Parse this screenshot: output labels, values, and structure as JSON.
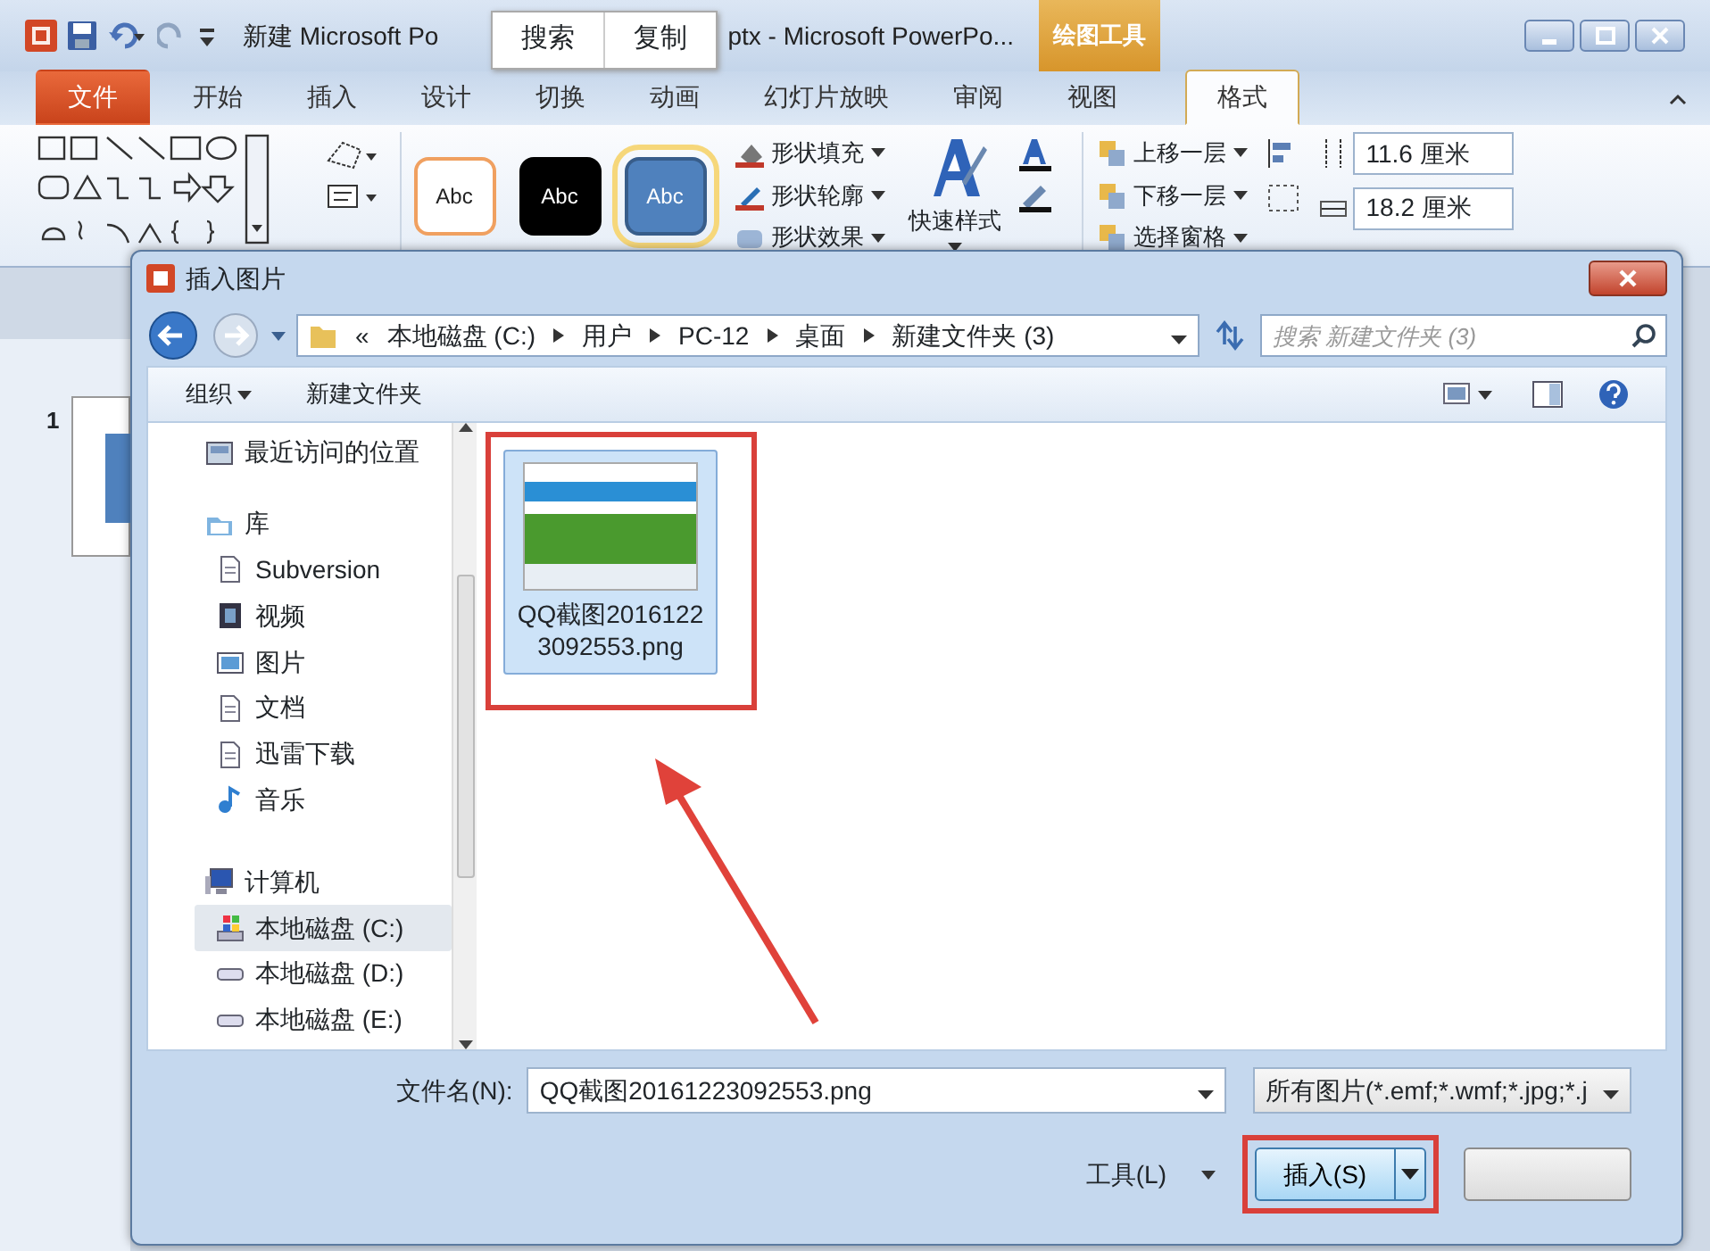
{
  "window": {
    "title_start": "新建 Microsoft Po",
    "title_end": "ptx - Microsoft PowerPo...",
    "context_tab_group": "绘图工具"
  },
  "popup_menu": [
    "搜索",
    "复制"
  ],
  "ribbon_tabs": [
    {
      "label": "文件",
      "kind": "file",
      "selected": false
    },
    {
      "label": "开始",
      "kind": "tab",
      "selected": false
    },
    {
      "label": "插入",
      "kind": "tab",
      "selected": false
    },
    {
      "label": "设计",
      "kind": "tab",
      "selected": false
    },
    {
      "label": "切换",
      "kind": "tab",
      "selected": false
    },
    {
      "label": "动画",
      "kind": "tab",
      "selected": false
    },
    {
      "label": "幻灯片放映",
      "kind": "tab",
      "selected": false
    },
    {
      "label": "审阅",
      "kind": "tab",
      "selected": false
    },
    {
      "label": "视图",
      "kind": "tab",
      "selected": false
    },
    {
      "label": "格式",
      "kind": "tab",
      "selected": true
    }
  ],
  "ribbon": {
    "style_presets": [
      {
        "label": "Abc",
        "kind": "outline"
      },
      {
        "label": "Abc",
        "kind": "dark"
      },
      {
        "label": "Abc",
        "kind": "blue"
      }
    ],
    "shape_commands": [
      "形状填充",
      "形状轮廓",
      "形状效果"
    ],
    "quick_styles": "快速样式",
    "arrange": [
      "上移一层",
      "下移一层",
      "选择窗格"
    ],
    "sizes": [
      "11.6 厘米",
      "18.2 厘米"
    ]
  },
  "slides": [
    {
      "number": "1"
    }
  ],
  "dialog": {
    "title": "插入图片",
    "breadcrumb": [
      "«",
      "本地磁盘 (C:)",
      "用户",
      "PC-12",
      "桌面",
      "新建文件夹 (3)"
    ],
    "search": {
      "placeholder": "搜索 新建文件夹 (3)"
    },
    "toolbar": [
      "组织",
      "新建文件夹"
    ],
    "nav": [
      {
        "label": "最近访问的位置",
        "selected": false
      },
      {
        "label": "库",
        "selected": false,
        "children": [
          {
            "label": "Subversion",
            "selected": false
          },
          {
            "label": "视频",
            "selected": false
          },
          {
            "label": "图片",
            "selected": false
          },
          {
            "label": "文档",
            "selected": false
          },
          {
            "label": "迅雷下载",
            "selected": false
          },
          {
            "label": "音乐",
            "selected": false
          }
        ]
      },
      {
        "label": "计算机",
        "selected": false,
        "children": [
          {
            "label": "本地磁盘 (C:)",
            "selected": true
          },
          {
            "label": "本地磁盘 (D:)",
            "selected": false
          },
          {
            "label": "本地磁盘 (E:)",
            "selected": false
          }
        ]
      }
    ],
    "files": [
      {
        "name": "QQ截图20161223092553.png",
        "selected": true
      }
    ],
    "filename_label": "文件名(N):",
    "filename": "QQ截图20161223092553.png",
    "filter": "所有图片(*.emf;*.wmf;*.jpg;*.j",
    "tools": "工具(L)",
    "insert_button": "插入(S)"
  }
}
